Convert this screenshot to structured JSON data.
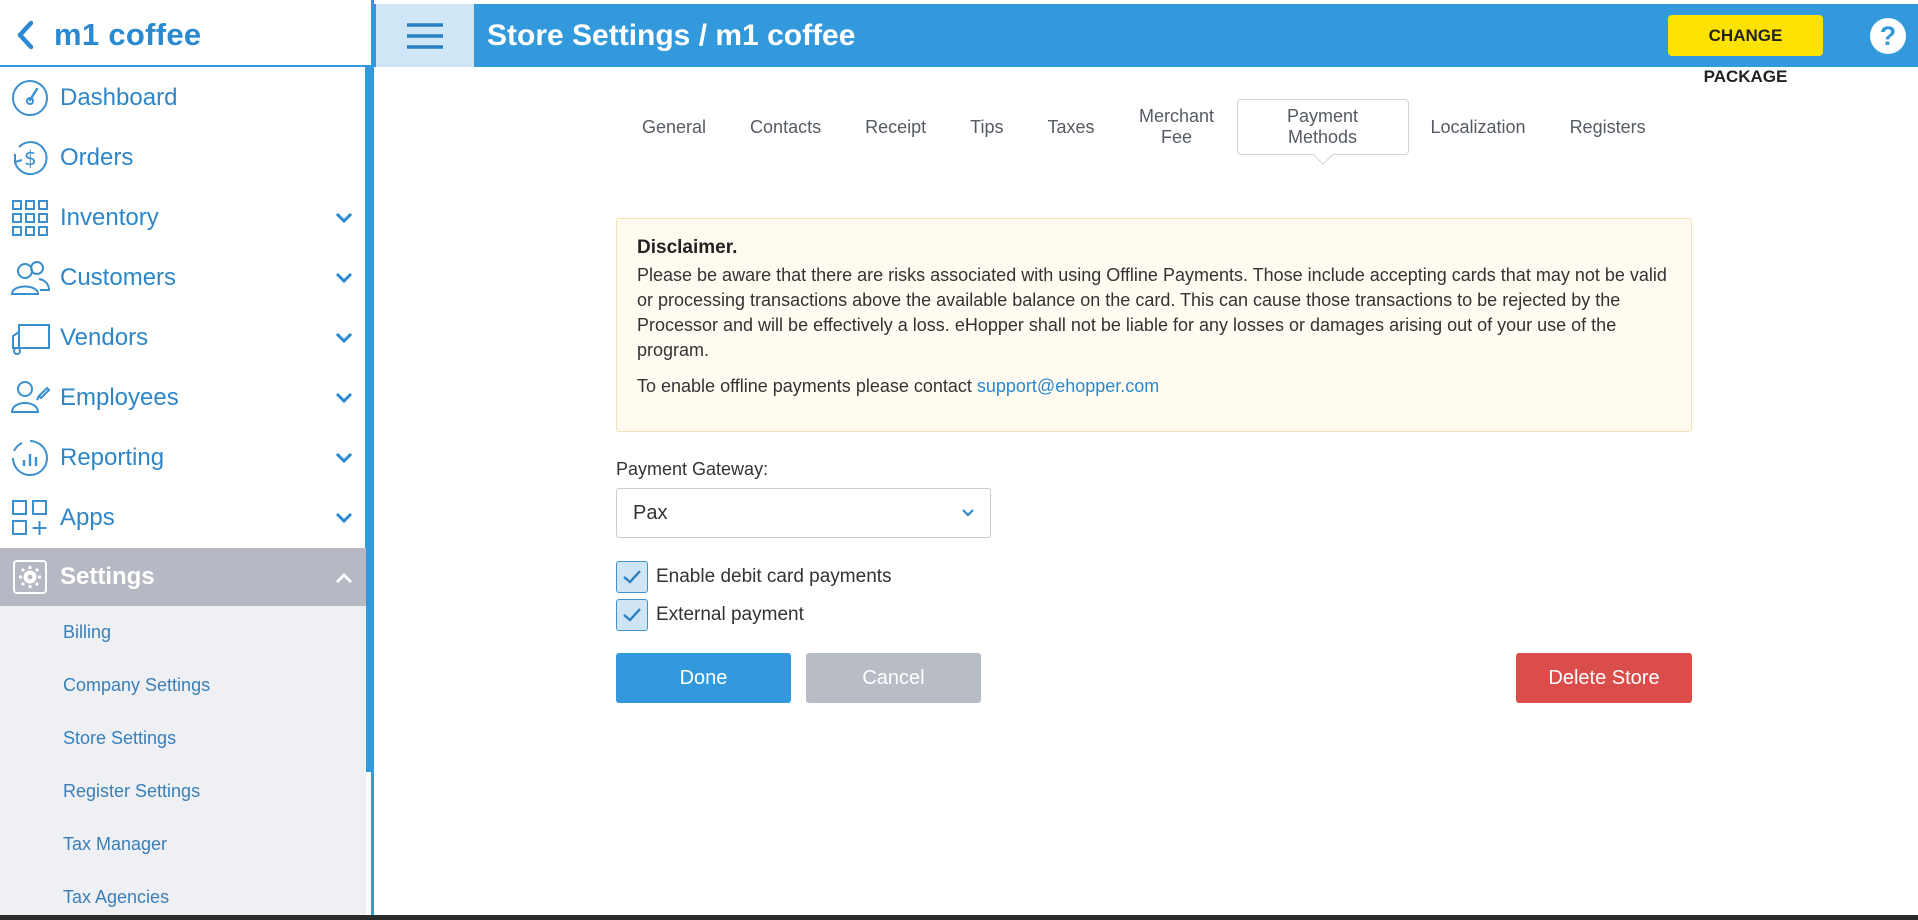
{
  "sidebar": {
    "store_name": "m1 coffee",
    "nav": [
      {
        "label": "Dashboard",
        "icon": "dashboard-gauge-icon",
        "expandable": false
      },
      {
        "label": "Orders",
        "icon": "dollar-cycle-icon",
        "expandable": false
      },
      {
        "label": "Inventory",
        "icon": "grid-icon",
        "expandable": true
      },
      {
        "label": "Customers",
        "icon": "people-icon",
        "expandable": true
      },
      {
        "label": "Vendors",
        "icon": "truck-icon",
        "expandable": true
      },
      {
        "label": "Employees",
        "icon": "employee-icon",
        "expandable": true
      },
      {
        "label": "Reporting",
        "icon": "bar-chart-icon",
        "expandable": true
      },
      {
        "label": "Apps",
        "icon": "apps-icon",
        "expandable": true
      },
      {
        "label": "Settings",
        "icon": "gear-icon",
        "expandable": true,
        "active": true
      }
    ],
    "settings_sub": [
      "Billing",
      "Company Settings",
      "Store Settings",
      "Register Settings",
      "Tax Manager",
      "Tax Agencies"
    ]
  },
  "topbar": {
    "title": "Store Settings / m1 coffee",
    "change_package": "CHANGE PACKAGE",
    "help": "?"
  },
  "tabs": [
    {
      "label": "General"
    },
    {
      "label": "Contacts"
    },
    {
      "label": "Receipt"
    },
    {
      "label": "Tips"
    },
    {
      "label": "Taxes"
    },
    {
      "label": "Merchant Fee"
    },
    {
      "label": "Payment Methods",
      "active": true
    },
    {
      "label": "Localization"
    },
    {
      "label": "Registers"
    }
  ],
  "disclaimer": {
    "title": "Disclaimer.",
    "body": "Please be aware that there are risks associated with using Offline Payments. Those include accepting cards that may not be valid or processing transactions above the available balance on the card. This can cause those transactions to be rejected by the Processor and will be effectively a loss. eHopper shall not be liable for any losses or damages arising out of your use of the program.",
    "contact_prefix": "To enable offline payments please contact ",
    "contact_email": "support@ehopper.com"
  },
  "form": {
    "gateway_label": "Payment Gateway:",
    "gateway_value": "Pax",
    "debit_label": "Enable debit card payments",
    "debit_checked": true,
    "external_label": "External payment",
    "external_checked": true
  },
  "buttons": {
    "done": "Done",
    "cancel": "Cancel",
    "delete": "Delete Store"
  },
  "colors": {
    "accent": "#3399dd",
    "change_package": "#fce200",
    "delete": "#da4d4a",
    "cancel": "#b8bcc5"
  }
}
